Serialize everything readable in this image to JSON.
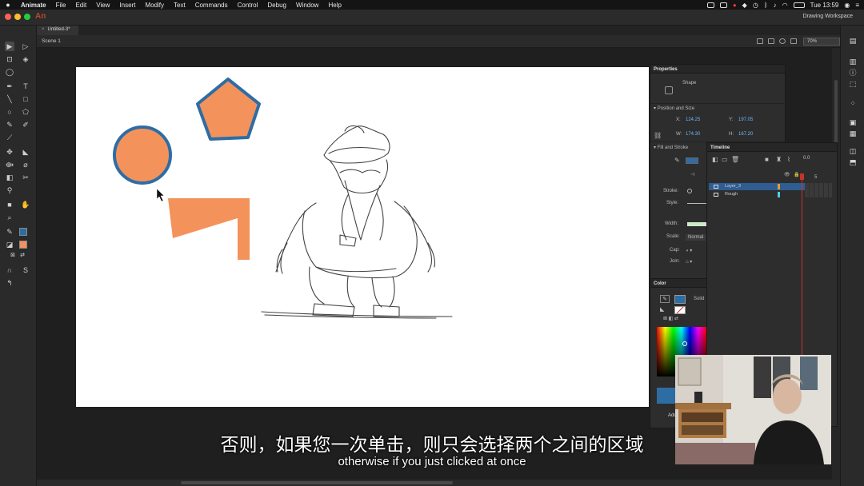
{
  "menubar": {
    "apple": "",
    "app": "Animate",
    "items": [
      "File",
      "Edit",
      "View",
      "Insert",
      "Modify",
      "Text",
      "Commands",
      "Control",
      "Debug",
      "Window",
      "Help"
    ],
    "clock": "Tue 13:59"
  },
  "titlebar": {
    "app_mark": "An",
    "workspace": "Drawing Workspace"
  },
  "document": {
    "tab": "Untitled-3*",
    "scene": "Scene 1",
    "zoom": "70%"
  },
  "properties": {
    "title": "Properties",
    "type": "Shape",
    "position_section": "Position and Size",
    "x_label": "X:",
    "x": "124.25",
    "y_label": "Y:",
    "y": "197.05",
    "w_label": "W:",
    "w": "174.30",
    "h_label": "H:",
    "h": "167.20",
    "fill_section": "Fill and Stroke",
    "stroke_label": "Stroke:",
    "style_label": "Style:",
    "width_label": "Width:",
    "scale_label": "Scale:",
    "scale": "Normal",
    "cap_label": "Cap:",
    "join_label": "Join:",
    "fill_color": "#2e6da4"
  },
  "timeline": {
    "title": "Timeline",
    "fps": "0.0",
    "frame_marker": "5",
    "layers": [
      {
        "name": "Layer_3",
        "selected": true,
        "color": "#e39a3c"
      },
      {
        "name": "Rough",
        "selected": false,
        "color": "#4ad0e6"
      }
    ]
  },
  "color_panel": {
    "title": "Color",
    "fill_type": "Solid",
    "stroke_color": "#2e6da4",
    "fill_color": "#f4925c",
    "add_button": "Add"
  },
  "stage_shapes": {
    "fill": "#f4925c",
    "stroke": "#2e6da4"
  },
  "subtitles": {
    "zh": "否则，如果您一次单击，则只会选择两个之间的区域",
    "en": "otherwise if you just clicked at once"
  }
}
